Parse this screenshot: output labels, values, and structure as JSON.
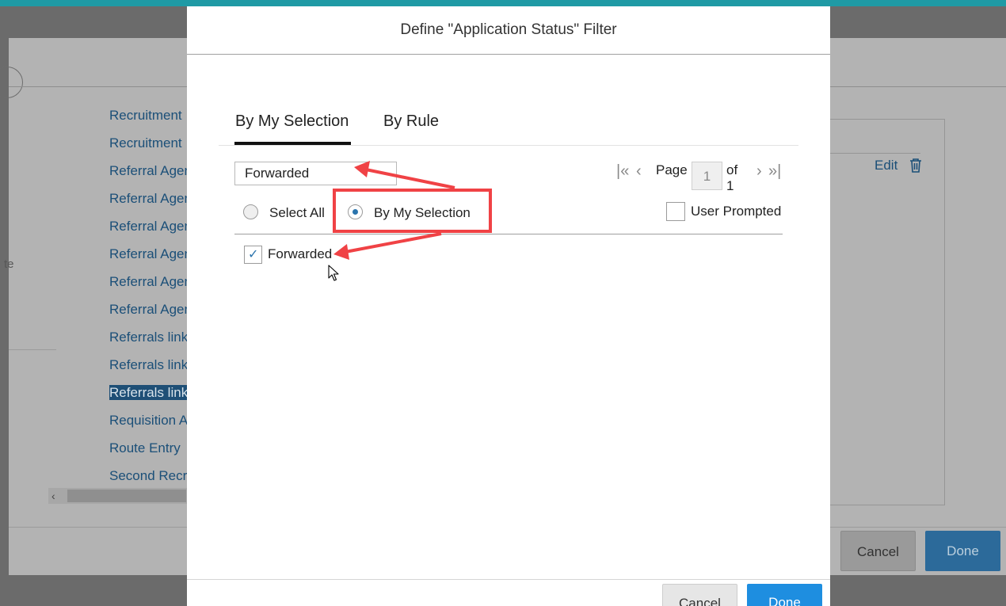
{
  "background": {
    "list_items": [
      "Recruitment",
      "Recruitment",
      "Referral Agen",
      "Referral Agen",
      "Referral Agen",
      "Referral Agen",
      "Referral Agen",
      "Referral Agen",
      "Referrals link",
      "Referrals link",
      "Referrals link",
      "Requisition A",
      "Route Entry",
      "Second Recr"
    ],
    "selected_index": 10,
    "side_text": "te",
    "edit_label": "Edit",
    "cancel_label": "Cancel",
    "done_label": "Done"
  },
  "dialog": {
    "title": "Define \"Application Status\" Filter",
    "tabs": [
      {
        "label": "By My Selection",
        "active": true
      },
      {
        "label": "By Rule",
        "active": false
      }
    ],
    "search_value": "Forwarded",
    "pager": {
      "page_label": "Page",
      "current_page": "1",
      "of_label": "of 1"
    },
    "options": {
      "select_all_label": "Select All",
      "by_my_selection_label": "By My Selection",
      "selected": "By My Selection",
      "user_prompted_label": "User Prompted",
      "user_prompted_checked": false
    },
    "items": [
      {
        "label": "Forwarded",
        "checked": true
      }
    ],
    "buttons": {
      "cancel": "Cancel",
      "done": "Done"
    }
  },
  "colors": {
    "accent": "#2b74ad",
    "primary_button": "#1e8ee0",
    "annotation": "#f04245",
    "top_strip": "#1f9aa5"
  }
}
